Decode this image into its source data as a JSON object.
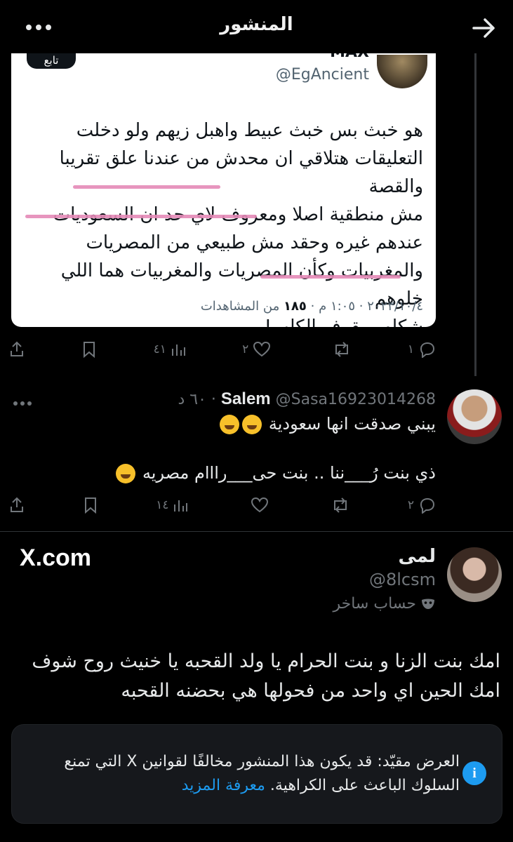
{
  "header": {
    "title": "المنشور",
    "back_icon": "arrow-right-icon",
    "more_icon": "more-horizontal-icon"
  },
  "embedded_tweet": {
    "name": "MAX",
    "handle": "@EgAncient",
    "follow_label": "تابع",
    "lines": [
      "هو خبث بس خبث عبيط واهبل زيهم ولو دخلت",
      "التعليقات هتلاقي ان محدش من عندنا علق تقريبا والقصة",
      "مش منطقية اصلا ومعروف لاي حد ان السعوديات",
      "عندهم غيره وحقد مش طبيعي من المصريات",
      "والمغربيات وكأن المصريات والمغربيات هما اللي خلوهم",
      "شكلهم يقرف الكلب!"
    ],
    "meta_time": "٢٠٢٣/١٠/٤ · ١:٠٥ م · ",
    "meta_views_count": "١٨٥",
    "meta_views_label": " من المشاهدات"
  },
  "main_actions": {
    "replies": "١",
    "reposts": "",
    "likes": "٢",
    "views": "٤١"
  },
  "reply": {
    "name": "Salem",
    "handle_time": "@Sasa16923014268 · ٦٠ د",
    "line1": "يبني صدقت انها سعودية",
    "line2": "ذي بنت رُ___ننا .. بنت حى___رااام مصريه",
    "actions": {
      "replies": "٢",
      "reposts": "",
      "likes": "",
      "views": "١٤"
    }
  },
  "quoted": {
    "name": "لمى",
    "handle": "@8lcsm",
    "label": "حساب ساخر",
    "watermark": "X.com",
    "lines": [
      "امك بنت الزنا و بنت الحرام يا ولد القحبه يا خنيث روح شوف",
      "امك الحين اي واحد من فحولها هي بحضنه القحبه"
    ]
  },
  "notice": {
    "text": "العرض مقيّد: قد يكون هذا المنشور مخالفًا لقوانين X التي تمنع السلوك الباعث على الكراهية.",
    "link": "معرفة المزيد",
    "icon": "info-icon"
  },
  "colors": {
    "background": "#000000",
    "accent": "#1d9bf0",
    "muted": "#71767b",
    "highlight": "#e48ab7"
  }
}
